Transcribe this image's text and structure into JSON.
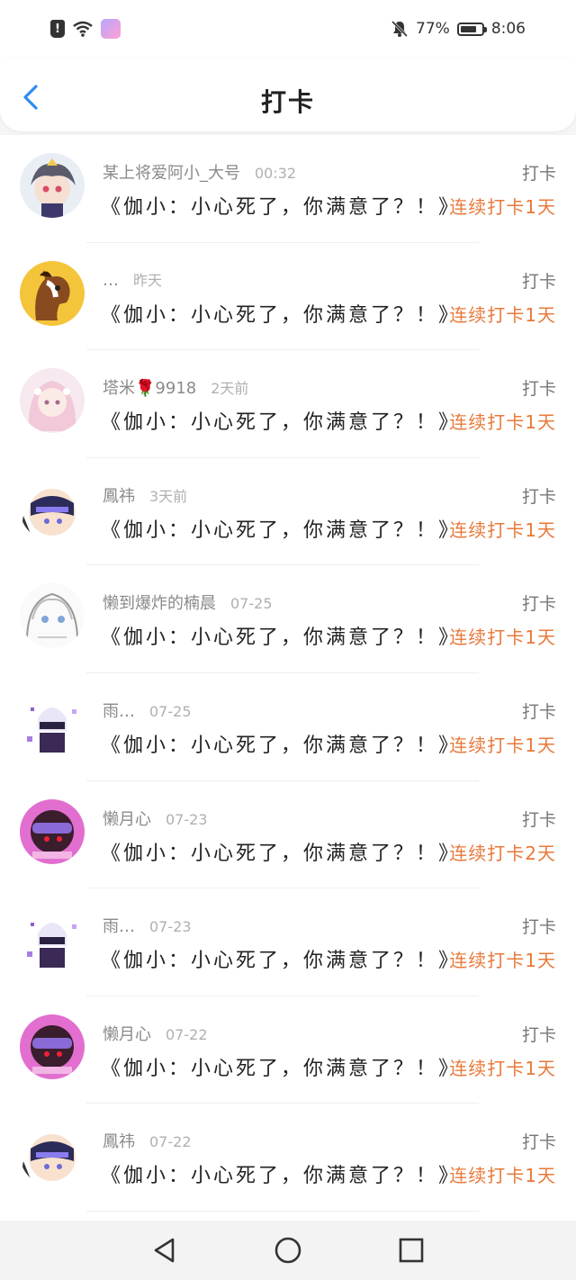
{
  "status": {
    "battery_percent": "77%",
    "time": "8:06",
    "battery_level": 0.77
  },
  "header": {
    "title": "打卡"
  },
  "items": [
    {
      "name": "某上将爱阿小_大号",
      "time": "00:32",
      "tag": "打卡",
      "content": "《伽小：小心死了，你满意了？！》",
      "streak": "连续打卡1天",
      "avatar": "anime-avatar-grey-hair"
    },
    {
      "name": "…",
      "time": "昨天",
      "tag": "打卡",
      "content": "《伽小：小心死了，你满意了？！》",
      "streak": "连续打卡1天",
      "avatar": "horse-avatar"
    },
    {
      "name": "塔米🌹9918",
      "time": "2天前",
      "tag": "打卡",
      "content": "《伽小：小心死了，你满意了？！》",
      "streak": "连续打卡1天",
      "avatar": "anime-avatar-pink-hair"
    },
    {
      "name": "鳳祎",
      "time": "3天前",
      "tag": "打卡",
      "content": "《伽小：小心死了，你满意了？！》",
      "streak": "连续打卡1天",
      "avatar": "anime-avatar-visor"
    },
    {
      "name": "懒到爆炸的楠晨",
      "time": "07-25",
      "tag": "打卡",
      "content": "《伽小：小心死了，你满意了？！》",
      "streak": "连续打卡1天",
      "avatar": "anime-avatar-sketch"
    },
    {
      "name": "雨…",
      "time": "07-25",
      "tag": "打卡",
      "content": "《伽小：小心死了，你满意了？！》",
      "streak": "连续打卡1天",
      "avatar": "masked-hero-avatar"
    },
    {
      "name": "懒月心",
      "time": "07-23",
      "tag": "打卡",
      "content": "《伽小：小心死了，你满意了？！》",
      "streak": "连续打卡2天",
      "avatar": "anime-avatar-purple-goggles"
    },
    {
      "name": "雨…",
      "time": "07-23",
      "tag": "打卡",
      "content": "《伽小：小心死了，你满意了？！》",
      "streak": "连续打卡1天",
      "avatar": "masked-hero-avatar"
    },
    {
      "name": "懒月心",
      "time": "07-22",
      "tag": "打卡",
      "content": "《伽小：小心死了，你满意了？！》",
      "streak": "连续打卡1天",
      "avatar": "anime-avatar-purple-goggles"
    },
    {
      "name": "鳳祎",
      "time": "07-22",
      "tag": "打卡",
      "content": "《伽小：小心死了，你满意了？！》",
      "streak": "连续打卡1天",
      "avatar": "anime-avatar-visor"
    }
  ],
  "colors": {
    "accent": "#2f8cf0",
    "streak": "#e8793a",
    "meta": "#8a8a8a"
  },
  "navbar": {
    "icons": [
      "back-triangle-icon",
      "home-circle-icon",
      "recents-square-icon"
    ]
  }
}
